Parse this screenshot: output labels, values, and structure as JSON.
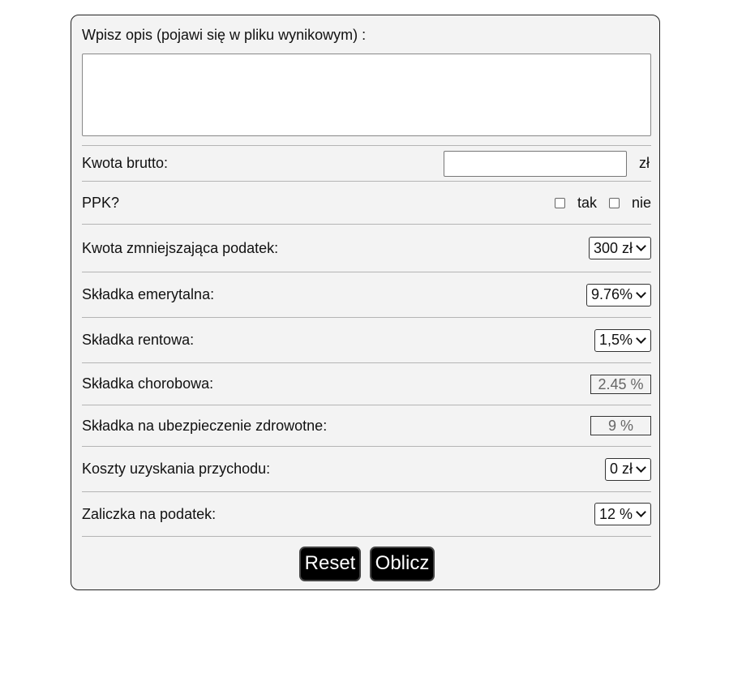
{
  "form": {
    "description_label": "Wpisz opis (pojawi się w pliku wynikowym) :",
    "description_value": "",
    "gross_label": "Kwota brutto:",
    "gross_value": "",
    "gross_unit": "zł",
    "ppk_label": "PPK?",
    "ppk_yes": "tak",
    "ppk_no": "nie",
    "tax_reduction_label": "Kwota zmniejszająca podatek:",
    "tax_reduction_value": "300 zł",
    "pension_label": "Składka emerytalna:",
    "pension_value": "9.76%",
    "disability_label": "Składka rentowa:",
    "disability_value": "1,5%",
    "sickness_label": "Składka chorobowa:",
    "sickness_value": "2.45 %",
    "health_label": "Składka na ubezpieczenie zdrowotne:",
    "health_value": "9 %",
    "costs_label": "Koszty uzyskania przychodu:",
    "costs_value": "0 zł",
    "tax_advance_label": "Zaliczka na podatek:",
    "tax_advance_value": "12 %"
  },
  "buttons": {
    "reset_label": "Reset",
    "calculate_label": "Oblicz"
  }
}
